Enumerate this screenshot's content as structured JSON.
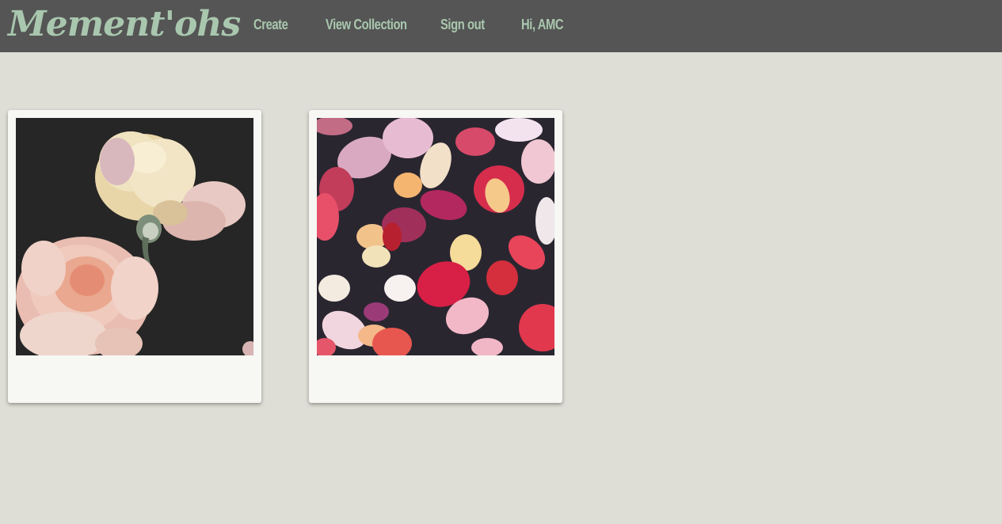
{
  "navbar": {
    "logo": "Mement'ohs",
    "links": {
      "create": "Create",
      "view_collection": "View Collection",
      "sign_out": "Sign out",
      "greeting": "Hi, AMC"
    }
  },
  "colors": {
    "navbar_bg": "#555555",
    "nav_text": "#a9c7ae",
    "page_bg": "#deded6",
    "card_bg": "#f7f7f4"
  },
  "collection": {
    "items": [
      {
        "image": "roses-on-dark-background"
      },
      {
        "image": "scattered-rose-petals"
      }
    ]
  }
}
